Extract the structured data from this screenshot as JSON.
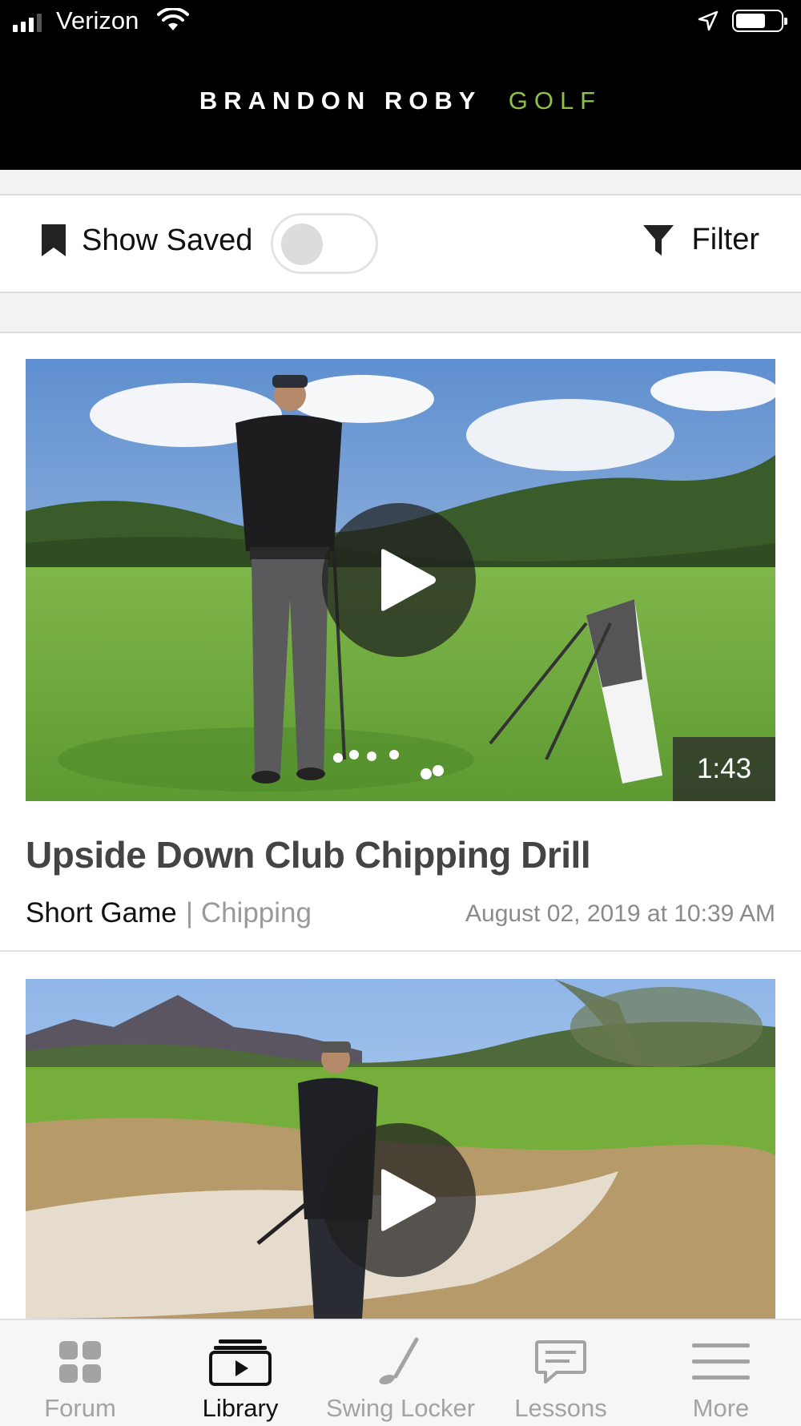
{
  "status_bar": {
    "carrier": "Verizon"
  },
  "header": {
    "brand_main": "BRANDON ROBY",
    "brand_accent": "GOLF"
  },
  "toolbar": {
    "show_saved_label": "Show Saved",
    "show_saved_on": false,
    "filter_label": "Filter"
  },
  "videos": [
    {
      "duration": "1:43",
      "title": "Upside Down Club Chipping Drill",
      "category": "Short Game",
      "subcategory": "| Chipping",
      "date": "August 02, 2019 at 10:39 AM"
    },
    {
      "duration": "",
      "title": "",
      "category": "",
      "subcategory": "",
      "date": ""
    }
  ],
  "tabs": [
    {
      "label": "Forum",
      "icon": "grid-icon",
      "active": false
    },
    {
      "label": "Library",
      "icon": "library-play-icon",
      "active": true
    },
    {
      "label": "Swing Locker",
      "icon": "golf-club-icon",
      "active": false
    },
    {
      "label": "Lessons",
      "icon": "chat-bubble-icon",
      "active": false
    },
    {
      "label": "More",
      "icon": "menu-icon",
      "active": false
    }
  ],
  "colors": {
    "brand_accent": "#8ebf48",
    "header_bg": "#000000",
    "active_tab": "#111111",
    "inactive_tab": "#a3a3a3"
  }
}
